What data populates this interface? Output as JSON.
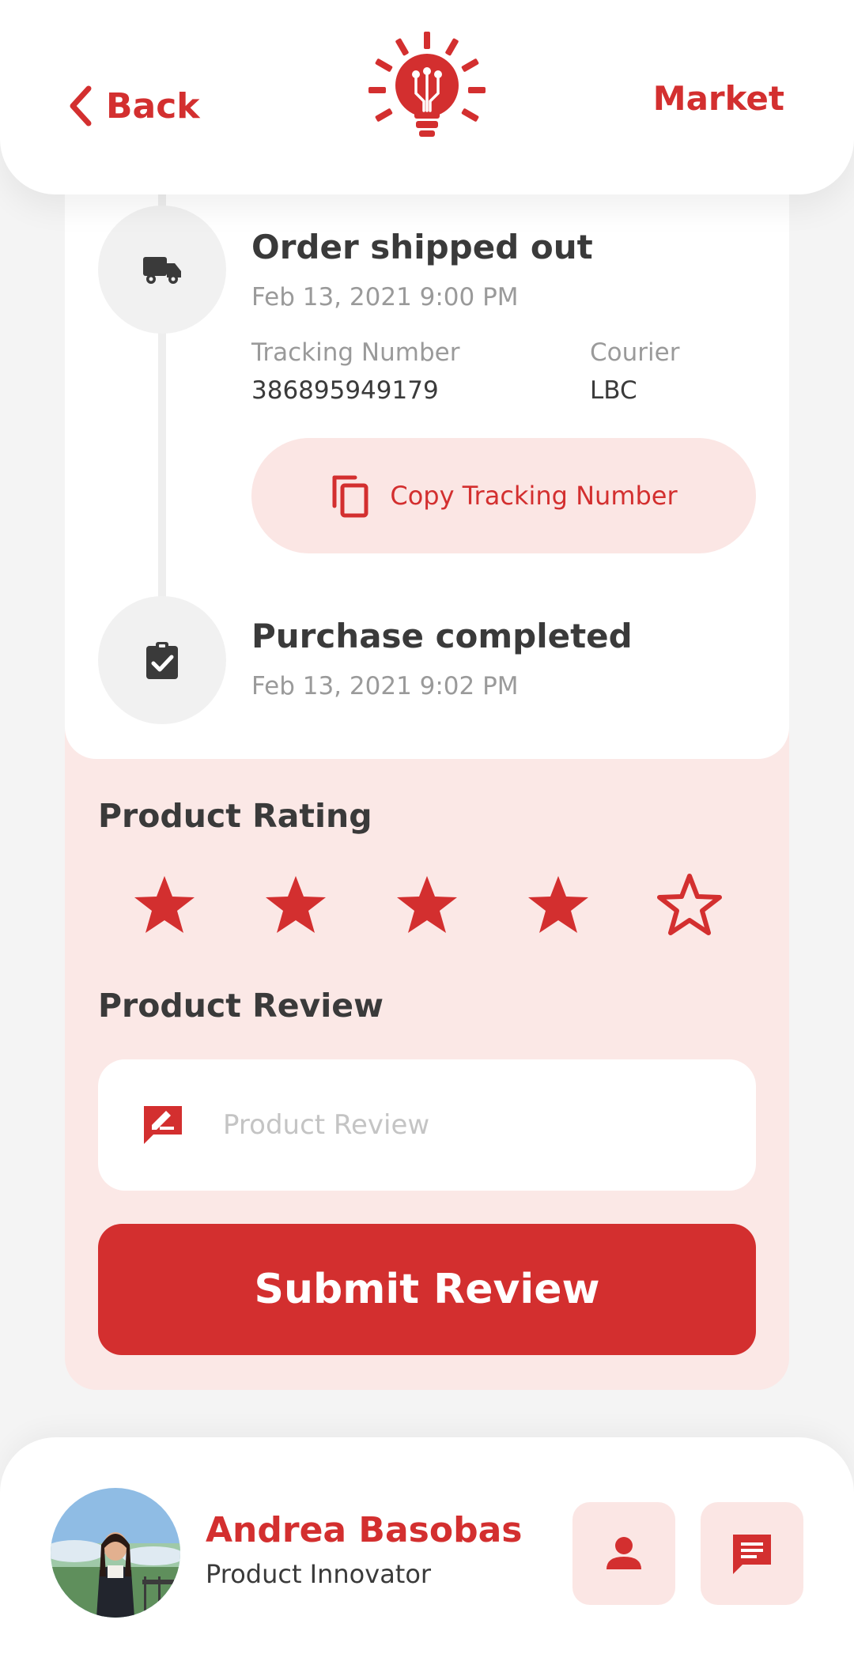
{
  "header": {
    "back_label": "Back",
    "market_label": "Market",
    "logo_icon": "lightbulb-sun-logo"
  },
  "colors": {
    "accent": "#d32f2f",
    "accent_light": "#fbe6e4",
    "text_dark": "#3a3a3a",
    "text_muted": "#9a9a9a"
  },
  "timeline": {
    "shipped": {
      "icon": "truck-icon",
      "title": "Order shipped out",
      "date": "Feb 13, 2021 9:00 PM",
      "tracking_label": "Tracking Number",
      "tracking_value": "386895949179",
      "courier_label": "Courier",
      "courier_value": "LBC",
      "copy_button_label": "Copy Tracking Number"
    },
    "completed": {
      "icon": "clipboard-check-icon",
      "title": "Purchase completed",
      "date": "Feb 13, 2021 9:02 PM"
    }
  },
  "rating": {
    "heading": "Product Rating",
    "value": 4,
    "max": 5
  },
  "review": {
    "heading": "Product Review",
    "placeholder": "Product Review",
    "value": "",
    "submit_label": "Submit Review"
  },
  "profile": {
    "name": "Andrea Basobas",
    "role": "Product Innovator",
    "actions": [
      "person-icon",
      "chat-icon"
    ]
  }
}
